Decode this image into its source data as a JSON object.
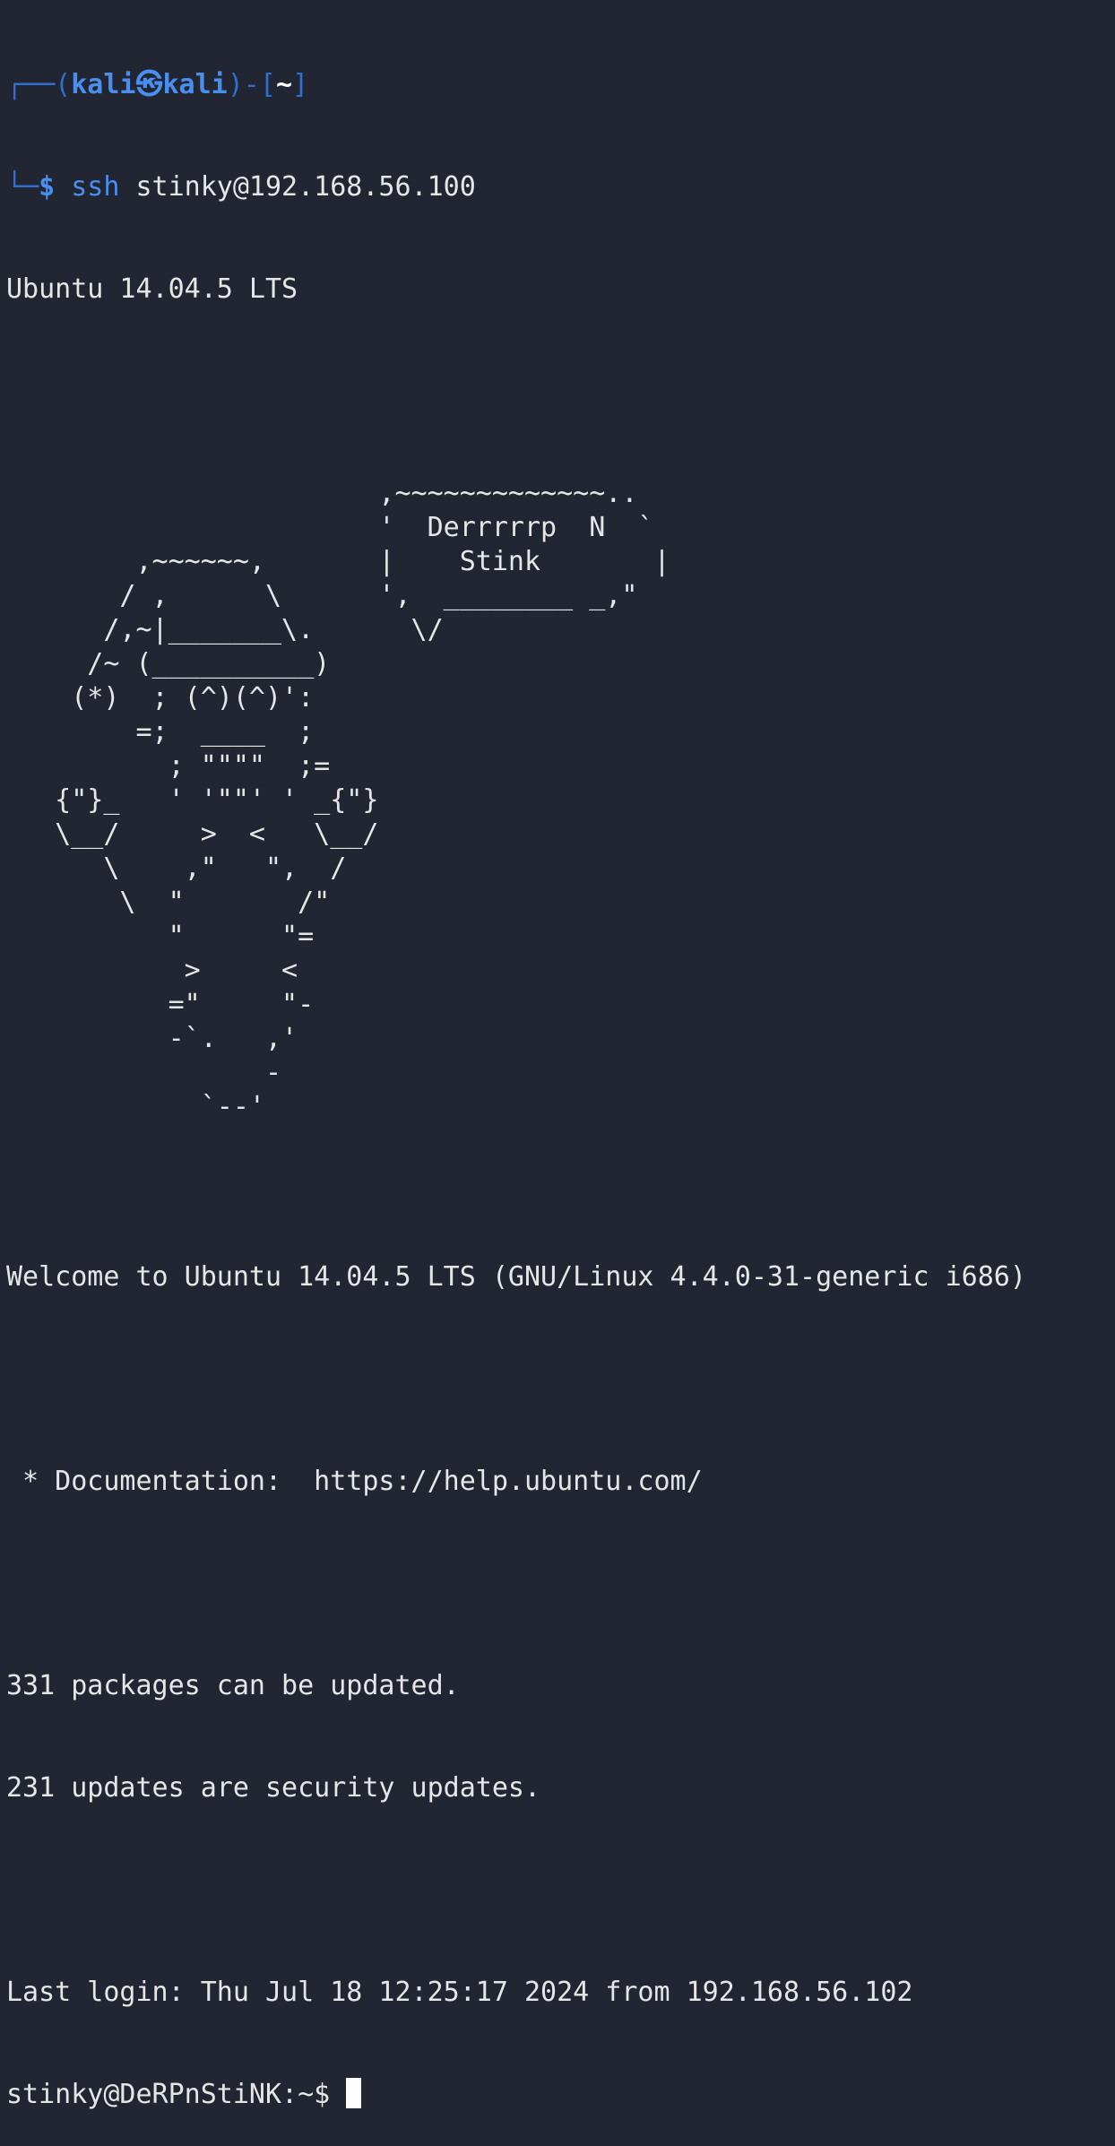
{
  "prompt": {
    "frame_top_left": "┌──(",
    "user": "kali",
    "at_symbol": "㉿",
    "host": "kali",
    "frame_mid": ")-[",
    "cwd": "~",
    "frame_close": "]",
    "frame_bottom": "└─",
    "dollar": "$",
    "command": "ssh",
    "command_args": " stinky@192.168.56.100"
  },
  "banner_line": "Ubuntu 14.04.5 LTS",
  "ascii_art": [
    "",
    "",
    "                       ,~~~~~~~~~~~~~..",
    "                       '  Derrrrrp  N  `",
    "        ,~~~~~~,       |    Stink       |",
    "       / ,      \\      ',  ________ _,\"",
    "      /,~|_______\\.      \\/",
    "     /~ (__________)",
    "    (*)  ; (^)(^)':",
    "        =;  ____  ;",
    "          ; \"\"\"\"  ;=",
    "   {\"}_   ' '\"\"' ' _{\"}",
    "   \\__/     >  <   \\__/",
    "      \\    ,\"   \",  /",
    "       \\  \"       /\"",
    "          \"      \"=",
    "           >     <",
    "          =\"     \"-",
    "          -`.   ,'",
    "                -",
    "            `--'",
    ""
  ],
  "welcome": "Welcome to Ubuntu 14.04.5 LTS (GNU/Linux 4.4.0-31-generic i686)",
  "documentation": " * Documentation:  https://help.ubuntu.com/",
  "packages": "331 packages can be updated.",
  "security": "231 updates are security updates.",
  "last_login": "Last login: Thu Jul 18 12:25:17 2024 from 192.168.56.102",
  "remote_prompt": "stinky@DeRPnStiNK:~$ "
}
